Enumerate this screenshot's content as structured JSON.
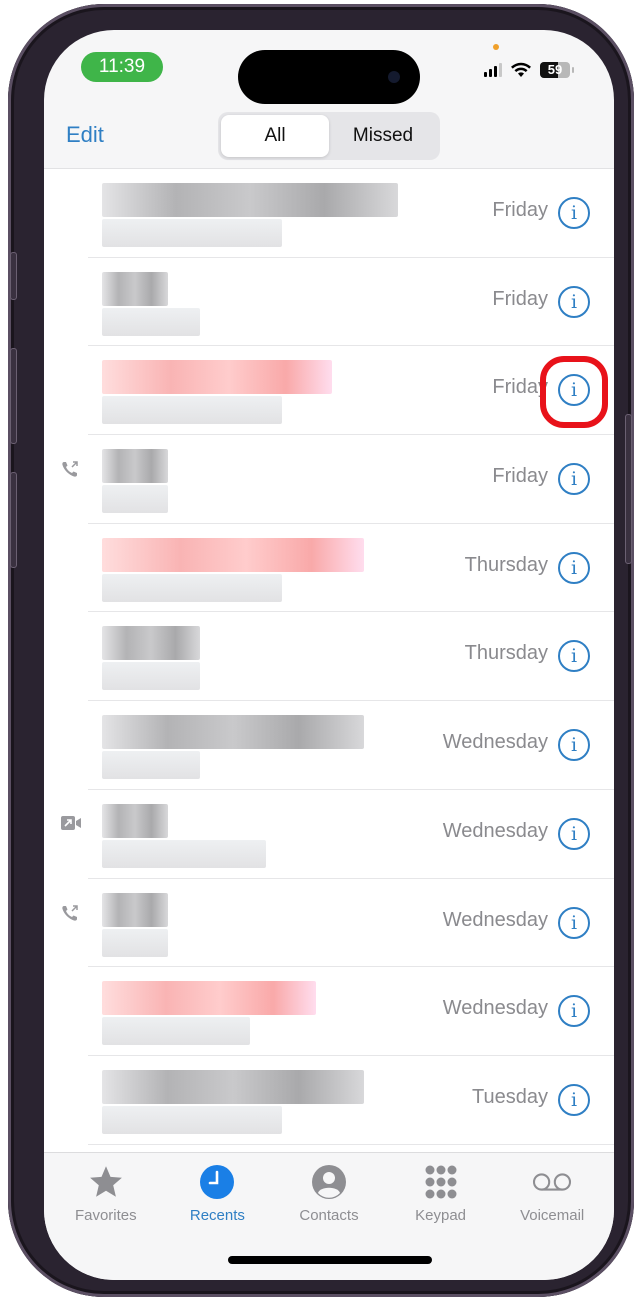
{
  "status_bar": {
    "time": "11:39",
    "battery_level": "59",
    "battery_fraction": 0.59,
    "signal_bars": 3,
    "signal_bars_total": 4
  },
  "nav": {
    "edit_label": "Edit",
    "segments": [
      {
        "label": "All",
        "active": true
      },
      {
        "label": "Missed",
        "active": false
      }
    ]
  },
  "recents": [
    {
      "name_redacted": true,
      "missed": false,
      "call_type_icon": null,
      "date": "Friday",
      "info_label": "i",
      "highlighted": false
    },
    {
      "name_redacted": true,
      "missed": false,
      "call_type_icon": null,
      "date": "Friday",
      "info_label": "i",
      "highlighted": false
    },
    {
      "name_redacted": true,
      "missed": true,
      "call_type_icon": null,
      "date": "Friday",
      "info_label": "i",
      "highlighted": true
    },
    {
      "name_redacted": true,
      "missed": false,
      "call_type_icon": "outgoing-call-icon",
      "date": "Friday",
      "info_label": "i",
      "highlighted": false
    },
    {
      "name_redacted": true,
      "missed": true,
      "call_type_icon": null,
      "date": "Thursday",
      "info_label": "i",
      "highlighted": false
    },
    {
      "name_redacted": true,
      "missed": false,
      "call_type_icon": null,
      "date": "Thursday",
      "info_label": "i",
      "highlighted": false
    },
    {
      "name_redacted": true,
      "missed": false,
      "call_type_icon": null,
      "date": "Wednesday",
      "info_label": "i",
      "highlighted": false
    },
    {
      "name_redacted": true,
      "missed": false,
      "call_type_icon": "outgoing-video-icon",
      "date": "Wednesday",
      "info_label": "i",
      "highlighted": false
    },
    {
      "name_redacted": true,
      "missed": false,
      "call_type_icon": "outgoing-call-icon",
      "date": "Wednesday",
      "info_label": "i",
      "highlighted": false
    },
    {
      "name_redacted": true,
      "missed": true,
      "call_type_icon": null,
      "date": "Wednesday",
      "info_label": "i",
      "highlighted": false
    },
    {
      "name_redacted": true,
      "missed": false,
      "call_type_icon": null,
      "date": "Tuesday",
      "info_label": "i",
      "highlighted": false
    }
  ],
  "tabbar": {
    "tabs": [
      {
        "label": "Favorites",
        "icon": "star-icon",
        "active": false
      },
      {
        "label": "Recents",
        "icon": "clock-icon",
        "active": true
      },
      {
        "label": "Contacts",
        "icon": "person-circle-icon",
        "active": false
      },
      {
        "label": "Keypad",
        "icon": "keypad-icon",
        "active": false
      },
      {
        "label": "Voicemail",
        "icon": "voicemail-icon",
        "active": false
      }
    ]
  },
  "colors": {
    "accent": "#2f7fc4",
    "time_pill": "#3fb549",
    "highlight_ring": "#e8121a",
    "secondary_text": "#8a8a8e",
    "missed_blur": "#f9b6b6",
    "normal_blur": "#b9b9bb"
  }
}
